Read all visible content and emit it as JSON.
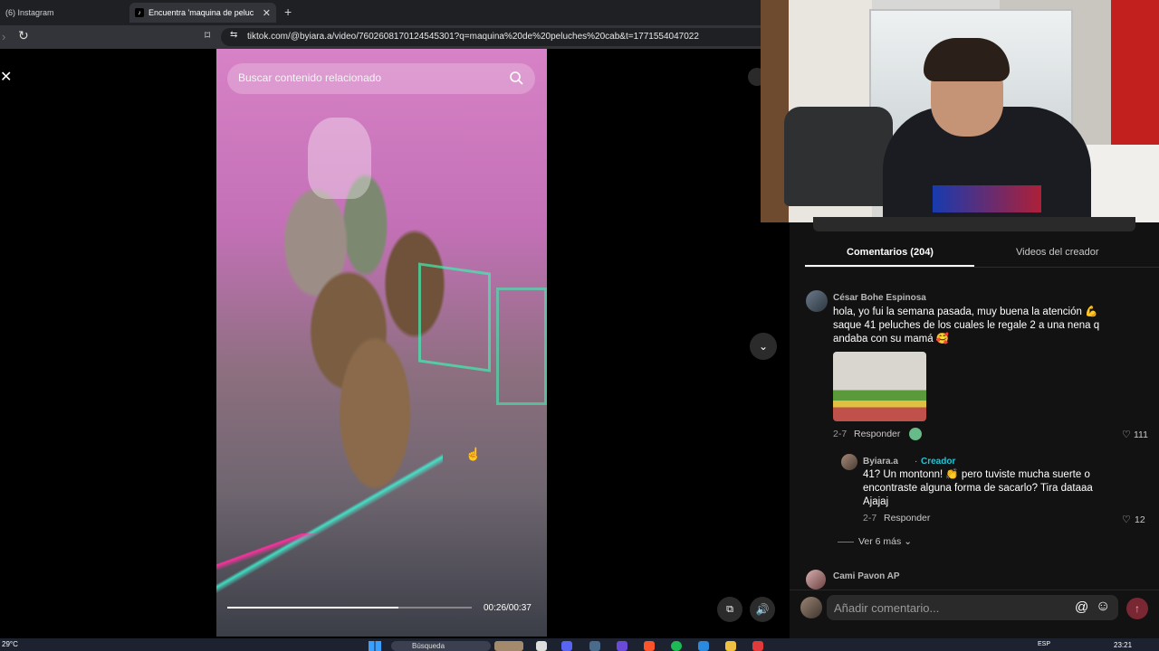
{
  "browser": {
    "tabs": [
      {
        "label": "(6) Instagram"
      },
      {
        "label": "Encuentra 'maquina de peluc"
      }
    ],
    "tab_close": "✕",
    "new_tab": "+",
    "url": "tiktok.com/@byiara.a/video/7602608170124545301?q=maquina%20de%20peluches%20cab&t=1771554047022"
  },
  "video": {
    "search_placeholder": "Buscar contenido relacionado",
    "timecode": "00:26/00:37",
    "progress": 0.7
  },
  "comments_panel": {
    "tabs": [
      {
        "label": "Comentarios (204)",
        "active": true
      },
      {
        "label": "Videos del creador",
        "active": false
      }
    ],
    "comment1": {
      "author": "César Bohe Espinosa",
      "lines": [
        "hola, yo fui la semana pasada, muy buena la atención 💪",
        "saque 41 peluches de los cuales le regale 2 a una nena q",
        "andaba con su mamá 🥰"
      ],
      "date": "2-7",
      "reply_label": "Responder",
      "likes": "111"
    },
    "reply1": {
      "author": "Byiara.a",
      "separator": "·",
      "badge": "Creador",
      "lines": [
        "41? Un montonn! 👏 pero tuviste mucha suerte o",
        "encontraste alguna forma de sacarlo? Tira dataaa",
        "Ajajaj"
      ],
      "date": "2-7",
      "reply_label": "Responder",
      "likes": "12"
    },
    "more_replies": "Ver 6 más",
    "comment2": {
      "author": "Cami Pavon AP"
    },
    "input_placeholder": "Añadir comentario...",
    "mention_symbol": "@"
  },
  "taskbar": {
    "weather": "29°C",
    "search": "Búsqueda",
    "lang": "ESP",
    "time": "23:21"
  },
  "colors": {
    "creator_badge": "#25c4d4",
    "send_button": "#7a2734",
    "panel_bg": "#121212"
  },
  "icons": [
    "close-icon",
    "search-icon",
    "chevron-down-icon",
    "volume-icon",
    "heart-icon",
    "emoji-icon",
    "reload-icon",
    "bookmark-icon"
  ]
}
